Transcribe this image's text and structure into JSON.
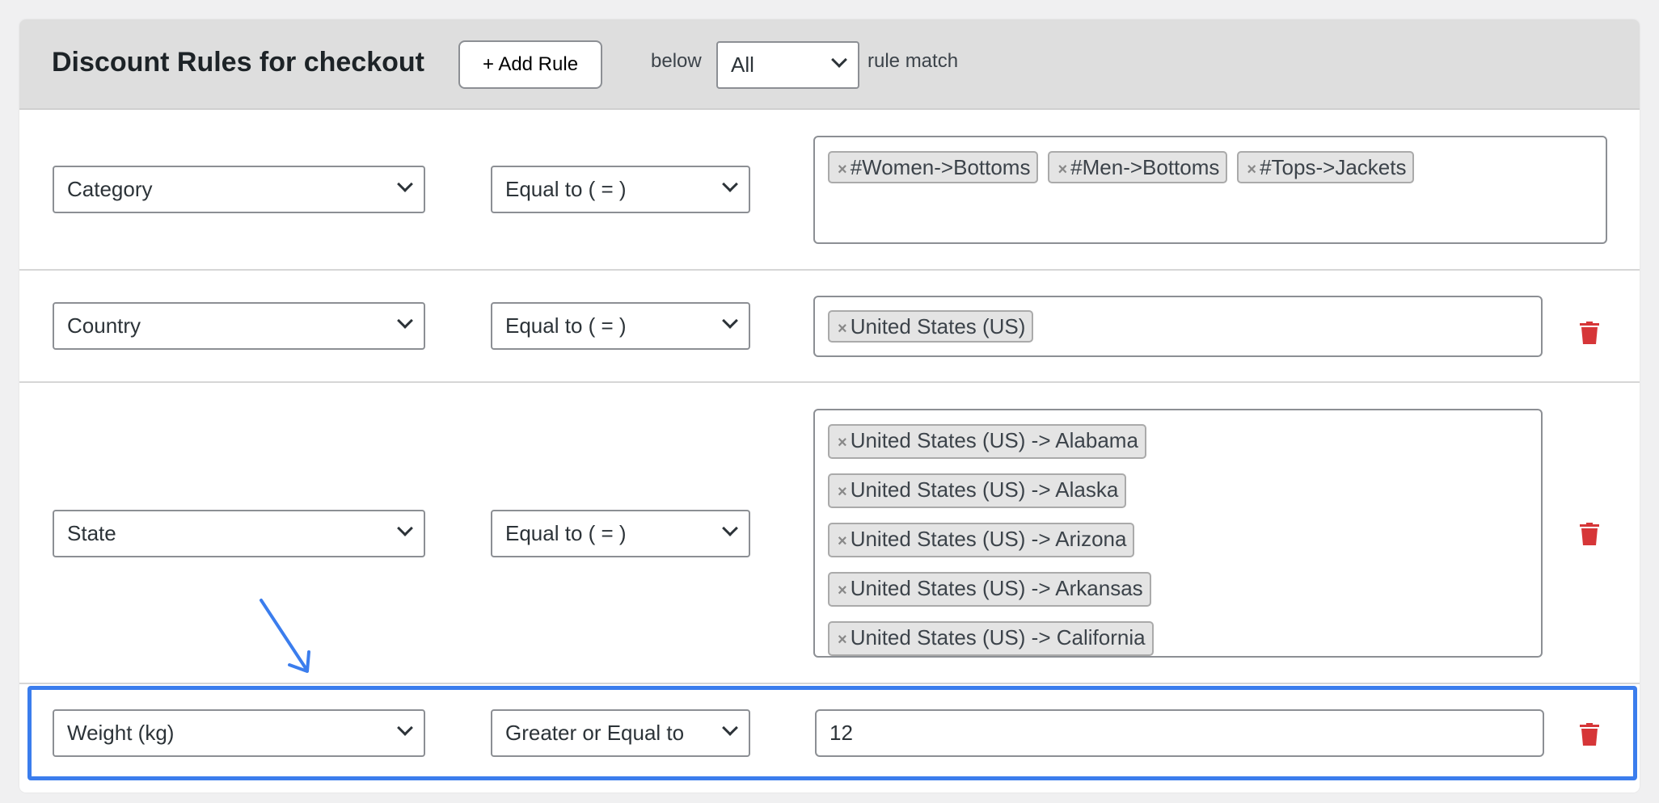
{
  "header": {
    "title": "Discount Rules for checkout",
    "add_rule_label": "+ Add Rule",
    "below_label": "below",
    "match_select": "All",
    "rule_match_label": "rule match"
  },
  "rules": [
    {
      "field": "Category",
      "operator": "Equal to ( = )",
      "tags": [
        "#Women->Bottoms",
        "#Men->Bottoms",
        "#Tops->Jackets"
      ],
      "deletable": false
    },
    {
      "field": "Country",
      "operator": "Equal to ( = )",
      "tags": [
        "United States (US)"
      ],
      "deletable": true
    },
    {
      "field": "State",
      "operator": "Equal to ( = )",
      "tags": [
        "United States (US) -> Alabama",
        "United States (US) -> Alaska",
        "United States (US) -> Arizona",
        "United States (US) -> Arkansas",
        "United States (US) -> California"
      ],
      "deletable": true
    },
    {
      "field": "Weight (kg)",
      "operator": "Greater or Equal to",
      "value": "12",
      "deletable": true,
      "highlighted": true
    }
  ],
  "icons": {
    "tag_remove": "x-icon",
    "delete": "trash-icon",
    "annotation": "arrow-icon",
    "dropdown": "chevron-down-icon"
  },
  "colors": {
    "delete": "#d63638",
    "highlight": "#3b7ded",
    "header_bg": "#dedede"
  }
}
